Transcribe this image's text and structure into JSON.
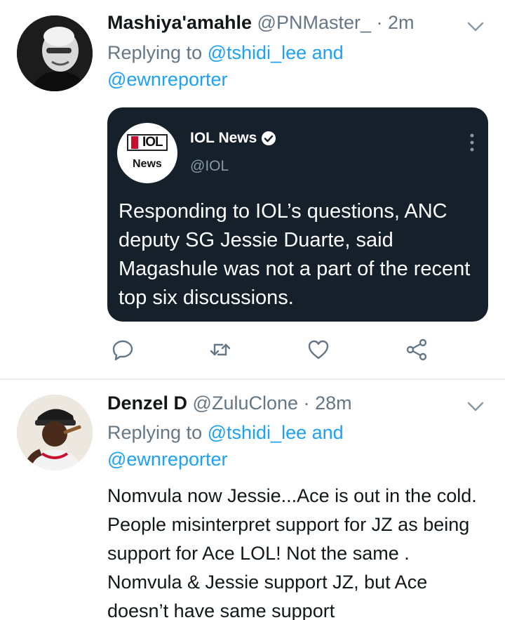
{
  "tweets": [
    {
      "display_name": "Mashiya'amahle",
      "handle": "@PNMaster_",
      "separator": "·",
      "time": "2m",
      "replying_prefix": "Replying to",
      "mention1": "@tshidi_lee",
      "conjunction": "and",
      "mention2": "@ewnreporter",
      "avatar_icon": "profile-photo",
      "quoted": {
        "logo_line1": "IOL",
        "logo_line2": "News",
        "name": "IOL News",
        "handle": "@IOL",
        "text": "Responding to IOL’s questions, ANC deputy SG Jessie Duarte, said Magashule was not a part of the recent top six discussions."
      },
      "actions": [
        "reply-icon",
        "retweet-icon",
        "like-icon",
        "share-icon"
      ]
    },
    {
      "display_name": "Denzel D",
      "handle": "@ZuluClone",
      "separator": "·",
      "time": "28m",
      "replying_prefix": "Replying to",
      "mention1": "@tshidi_lee",
      "conjunction": "and",
      "mention2": "@ewnreporter",
      "avatar_icon": "profile-photo",
      "text": "Nomvula now Jessie...Ace is out in the cold. People misinterpret support for JZ as being support for Ace LOL! Not the same . Nomvula & Jessie support JZ, but Ace doesn’t have same support"
    }
  ],
  "colors": {
    "link": "#1da1f2",
    "secondary_text": "#657786",
    "card_background": "#15202b",
    "primary_text": "#14171a"
  }
}
